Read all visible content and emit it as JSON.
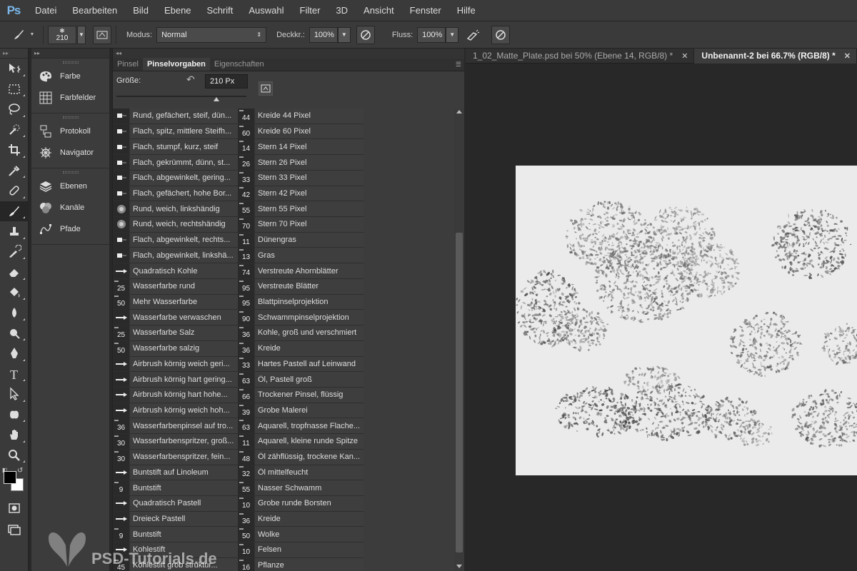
{
  "menubar": {
    "logo": "Ps",
    "items": [
      "Datei",
      "Bearbeiten",
      "Bild",
      "Ebene",
      "Schrift",
      "Auswahl",
      "Filter",
      "3D",
      "Ansicht",
      "Fenster",
      "Hilfe"
    ]
  },
  "options": {
    "brush_size": "210",
    "modus_label": "Modus:",
    "modus_value": "Normal",
    "deckkr_label": "Deckkr.:",
    "deckkr_value": "100%",
    "fluss_label": "Fluss:",
    "fluss_value": "100%"
  },
  "dock": {
    "groups": [
      [
        {
          "label": "Farbe",
          "icon": "palette-icon"
        },
        {
          "label": "Farbfelder",
          "icon": "swatches-icon"
        }
      ],
      [
        {
          "label": "Protokoll",
          "icon": "history-icon"
        },
        {
          "label": "Navigator",
          "icon": "navigator-icon"
        }
      ],
      [
        {
          "label": "Ebenen",
          "icon": "layers-icon"
        },
        {
          "label": "Kanäle",
          "icon": "channels-icon"
        },
        {
          "label": "Pfade",
          "icon": "paths-icon"
        }
      ]
    ]
  },
  "brush_panel": {
    "tabs": [
      "Pinsel",
      "Pinselvorgaben",
      "Eigenschaften"
    ],
    "active_tab": 1,
    "size_label": "Größe:",
    "size_value": "210 Px",
    "size_fraction": 0.77,
    "left_column": [
      {
        "num": "",
        "name": "Rund, gefächert, steif, dün..."
      },
      {
        "num": "",
        "name": "Flach, spitz, mittlere Steifh..."
      },
      {
        "num": "",
        "name": "Flach, stumpf, kurz, steif"
      },
      {
        "num": "",
        "name": "Flach, gekrümmt, dünn, st..."
      },
      {
        "num": "",
        "name": "Flach, abgewinkelt, gering..."
      },
      {
        "num": "",
        "name": "Flach, gefächert, hohe Bor..."
      },
      {
        "num": "",
        "name": "Rund, weich, linkshändig"
      },
      {
        "num": "",
        "name": "Rund, weich, rechtshändig"
      },
      {
        "num": "",
        "name": "Flach, abgewinkelt, rechts..."
      },
      {
        "num": "",
        "name": "Flach, abgewinkelt, linkshä..."
      },
      {
        "num": "",
        "name": "Quadratisch Kohle"
      },
      {
        "num": "25",
        "name": "Wasserfarbe rund"
      },
      {
        "num": "50",
        "name": "Mehr Wasserfarbe"
      },
      {
        "num": "",
        "name": "Wasserfarbe verwaschen"
      },
      {
        "num": "25",
        "name": "Wasserfarbe Salz"
      },
      {
        "num": "50",
        "name": "Wasserfarbe salzig"
      },
      {
        "num": "",
        "name": "Airbrush körnig weich geri..."
      },
      {
        "num": "",
        "name": "Airbrush körnig hart gering..."
      },
      {
        "num": "",
        "name": "Airbrush körnig hart hohe..."
      },
      {
        "num": "",
        "name": "Airbrush körnig weich hoh..."
      },
      {
        "num": "36",
        "name": "Wasserfarbenpinsel auf tro..."
      },
      {
        "num": "30",
        "name": "Wasserfarbenspritzer, groß..."
      },
      {
        "num": "30",
        "name": "Wasserfarbenspritzer, fein..."
      },
      {
        "num": "",
        "name": "Buntstift auf Linoleum"
      },
      {
        "num": "9",
        "name": "Buntstift"
      },
      {
        "num": "",
        "name": "Quadratisch Pastell"
      },
      {
        "num": "",
        "name": "Dreieck Pastell"
      },
      {
        "num": "9",
        "name": "Buntstift"
      },
      {
        "num": "",
        "name": "Kohlestift"
      },
      {
        "num": "45",
        "name": "Kohlestift grob struktur..."
      }
    ],
    "right_column": [
      {
        "num": "44",
        "name": "Kreide 44 Pixel"
      },
      {
        "num": "60",
        "name": "Kreide 60 Pixel"
      },
      {
        "num": "14",
        "name": "Stern 14 Pixel"
      },
      {
        "num": "26",
        "name": "Stern 26 Pixel"
      },
      {
        "num": "33",
        "name": "Stern 33 Pixel"
      },
      {
        "num": "42",
        "name": "Stern 42 Pixel"
      },
      {
        "num": "55",
        "name": "Stern 55 Pixel"
      },
      {
        "num": "70",
        "name": "Stern 70 Pixel"
      },
      {
        "num": "11",
        "name": "Dünengras"
      },
      {
        "num": "13",
        "name": "Gras"
      },
      {
        "num": "74",
        "name": "Verstreute Ahornblätter"
      },
      {
        "num": "95",
        "name": "Verstreute Blätter"
      },
      {
        "num": "95",
        "name": "Blattpinselprojektion"
      },
      {
        "num": "90",
        "name": "Schwammpinselprojektion"
      },
      {
        "num": "36",
        "name": "Kohle, groß und verschmiert"
      },
      {
        "num": "36",
        "name": "Kreide"
      },
      {
        "num": "33",
        "name": "Hartes Pastell auf Leinwand"
      },
      {
        "num": "63",
        "name": "Öl, Pastell groß"
      },
      {
        "num": "66",
        "name": "Trockener Pinsel, flüssig"
      },
      {
        "num": "39",
        "name": "Grobe Malerei"
      },
      {
        "num": "63",
        "name": "Aquarell, tropfnasse Flache..."
      },
      {
        "num": "11",
        "name": "Aquarell, kleine runde Spitze"
      },
      {
        "num": "48",
        "name": "Öl zähflüssig, trockene Kan..."
      },
      {
        "num": "32",
        "name": "Öl mittelfeucht"
      },
      {
        "num": "55",
        "name": "Nasser Schwamm"
      },
      {
        "num": "10",
        "name": "Grobe runde Borsten"
      },
      {
        "num": "36",
        "name": "Kreide"
      },
      {
        "num": "50",
        "name": "Wolke"
      },
      {
        "num": "10",
        "name": "Felsen"
      },
      {
        "num": "16",
        "name": "Pflanze"
      }
    ]
  },
  "documents": {
    "tabs": [
      {
        "label": "1_02_Matte_Plate.psd bei 50% (Ebene 14, RGB/8) *",
        "active": false
      },
      {
        "label": "Unbenannt-2 bei 66.7% (RGB/8) *",
        "active": true
      }
    ]
  },
  "tools": [
    "move-tool-icon",
    "marquee-tool-icon",
    "lasso-tool-icon",
    "quick-selection-tool-icon",
    "crop-tool-icon",
    "eyedropper-tool-icon",
    "healing-brush-tool-icon",
    "brush-tool-icon",
    "clone-stamp-tool-icon",
    "history-brush-tool-icon",
    "eraser-tool-icon",
    "paint-bucket-tool-icon",
    "blur-tool-icon",
    "dodge-tool-icon",
    "pen-tool-icon",
    "type-tool-icon",
    "path-selection-tool-icon",
    "custom-shape-tool-icon",
    "hand-tool-icon",
    "zoom-tool-icon"
  ],
  "watermark": {
    "text": "PSD-Tutorials.de"
  }
}
